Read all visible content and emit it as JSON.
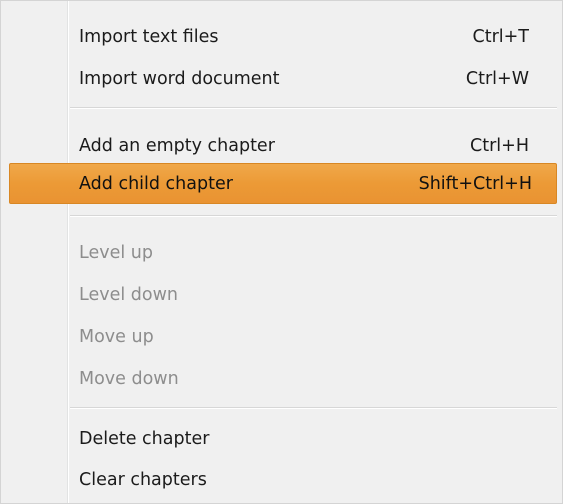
{
  "menu": {
    "group1": [
      {
        "label": "Import text files",
        "shortcut": "Ctrl+T"
      },
      {
        "label": "Import word document",
        "shortcut": "Ctrl+W"
      }
    ],
    "group2": [
      {
        "label": "Add an empty chapter",
        "shortcut": "Ctrl+H"
      },
      {
        "label": "Add child chapter",
        "shortcut": "Shift+Ctrl+H",
        "state": "highlighted"
      }
    ],
    "group3": [
      {
        "label": "Level up",
        "state": "disabled"
      },
      {
        "label": "Level down",
        "state": "disabled"
      },
      {
        "label": "Move up",
        "state": "disabled"
      },
      {
        "label": "Move down",
        "state": "disabled"
      }
    ],
    "group4": [
      {
        "label": "Delete chapter"
      },
      {
        "label": "Clear chapters"
      }
    ]
  },
  "colors": {
    "menu_background": "#f0f0f0",
    "highlight": "#ec9a36",
    "highlight_border": "#d88724",
    "disabled_text": "#8d8d8d",
    "text": "#1b1b1b"
  }
}
